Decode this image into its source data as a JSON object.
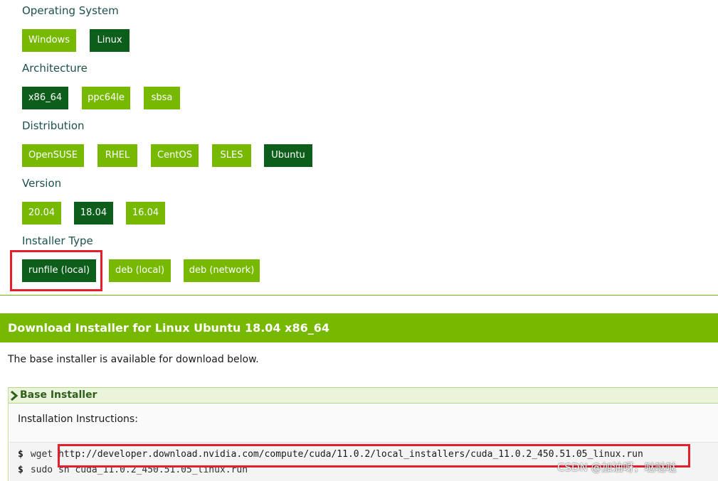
{
  "selector": {
    "operating_system": {
      "label": "Operating System",
      "options": [
        "Windows",
        "Linux"
      ],
      "selected": "Linux"
    },
    "architecture": {
      "label": "Architecture",
      "options": [
        "x86_64",
        "ppc64le",
        "sbsa"
      ],
      "selected": "x86_64"
    },
    "distribution": {
      "label": "Distribution",
      "options": [
        "OpenSUSE",
        "RHEL",
        "CentOS",
        "SLES",
        "Ubuntu"
      ],
      "selected": "Ubuntu"
    },
    "version": {
      "label": "Version",
      "options": [
        "20.04",
        "18.04",
        "16.04"
      ],
      "selected": "18.04"
    },
    "installer_type": {
      "label": "Installer Type",
      "options": [
        "runfile (local)",
        "deb (local)",
        "deb (network)"
      ],
      "selected": "runfile (local)"
    }
  },
  "download": {
    "title": "Download Installer for Linux Ubuntu 18.04 x86_64",
    "info": "The base installer is available for download below.",
    "panel_title": "Base Installer",
    "instructions_label": "Installation Instructions:",
    "commands": [
      {
        "prompt": "$",
        "cmd": "wget",
        "arg": "http://developer.download.nvidia.com/compute/cuda/11.0.2/local_installers/cuda_11.0.2_450.51.05_linux.run"
      },
      {
        "prompt": "$",
        "cmd": "sudo sh",
        "arg": "cuda_11.0.2_450.51.05_linux.run"
      }
    ]
  },
  "watermark": "CSDN @加油呀，哒哒哒",
  "colors": {
    "accent": "#76b900",
    "selected": "#0d5e1a",
    "highlight": "#e31f2d"
  },
  "icons": {
    "panel_toggle": "chevron-right-icon"
  }
}
